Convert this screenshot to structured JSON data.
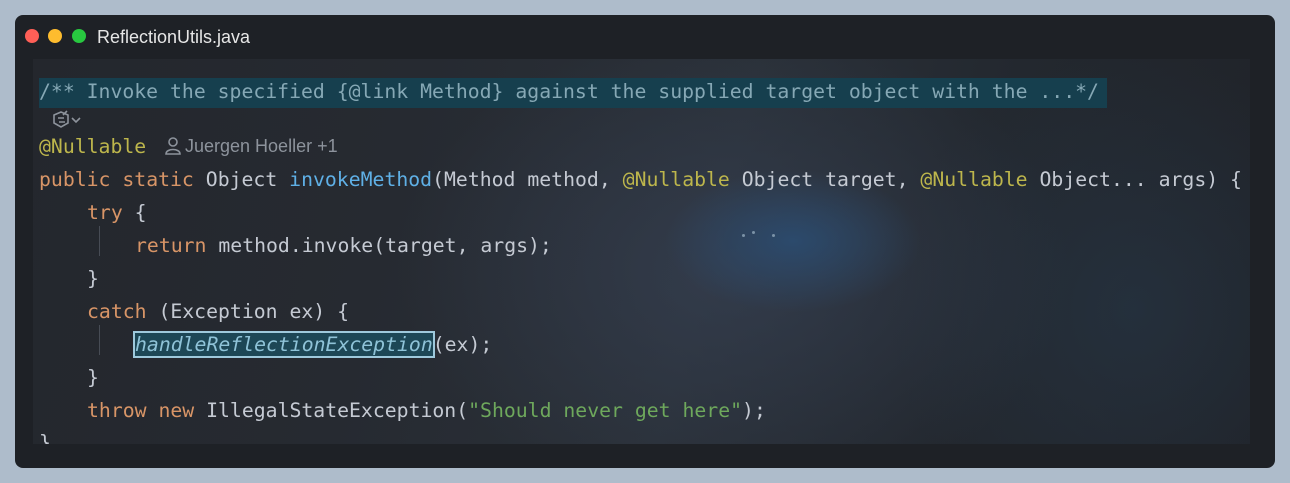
{
  "window": {
    "title": "ReflectionUtils.java"
  },
  "editor": {
    "doc_comment": "/** Invoke the specified {@link Method} against the supplied target object with the ...*/",
    "annotation": "@Nullable",
    "author_hint": "Juergen Hoeller +1",
    "lines": {
      "l3": {
        "public": "public",
        "static": "static",
        "type": "Object",
        "method_name": "invokeMethod",
        "open": "(Method method, ",
        "ann1": "@Nullable",
        "mid": " Object target, ",
        "ann2": "@Nullable",
        "end": " Object... args) {"
      },
      "l4": {
        "kw": "try",
        "rest": " {"
      },
      "l5": {
        "kw": "return",
        "rest": " method.invoke(target, args);"
      },
      "l6": {
        "text": "}"
      },
      "l7": {
        "kw": "catch",
        "rest": " (Exception ex) {"
      },
      "l8": {
        "call": "handleReflectionException",
        "rest": "(ex);"
      },
      "l9": {
        "text": "}"
      },
      "l10": {
        "kw1": "throw",
        "kw2": "new",
        "cls": " IllegalStateException(",
        "str": "\"Should never get here\"",
        "end": ");"
      },
      "l11": {
        "text": "}"
      }
    }
  },
  "icons": {
    "window_controls": [
      "close-icon",
      "minimize-icon",
      "maximize-icon"
    ],
    "inlay": "ai-sparkle-icon",
    "author": "person-icon"
  },
  "colors": {
    "keyword": "#d89567",
    "function": "#5fb0e6",
    "annotation": "#bdb64c",
    "string": "#6ea85c",
    "doc_comment": "#86a8b5"
  }
}
